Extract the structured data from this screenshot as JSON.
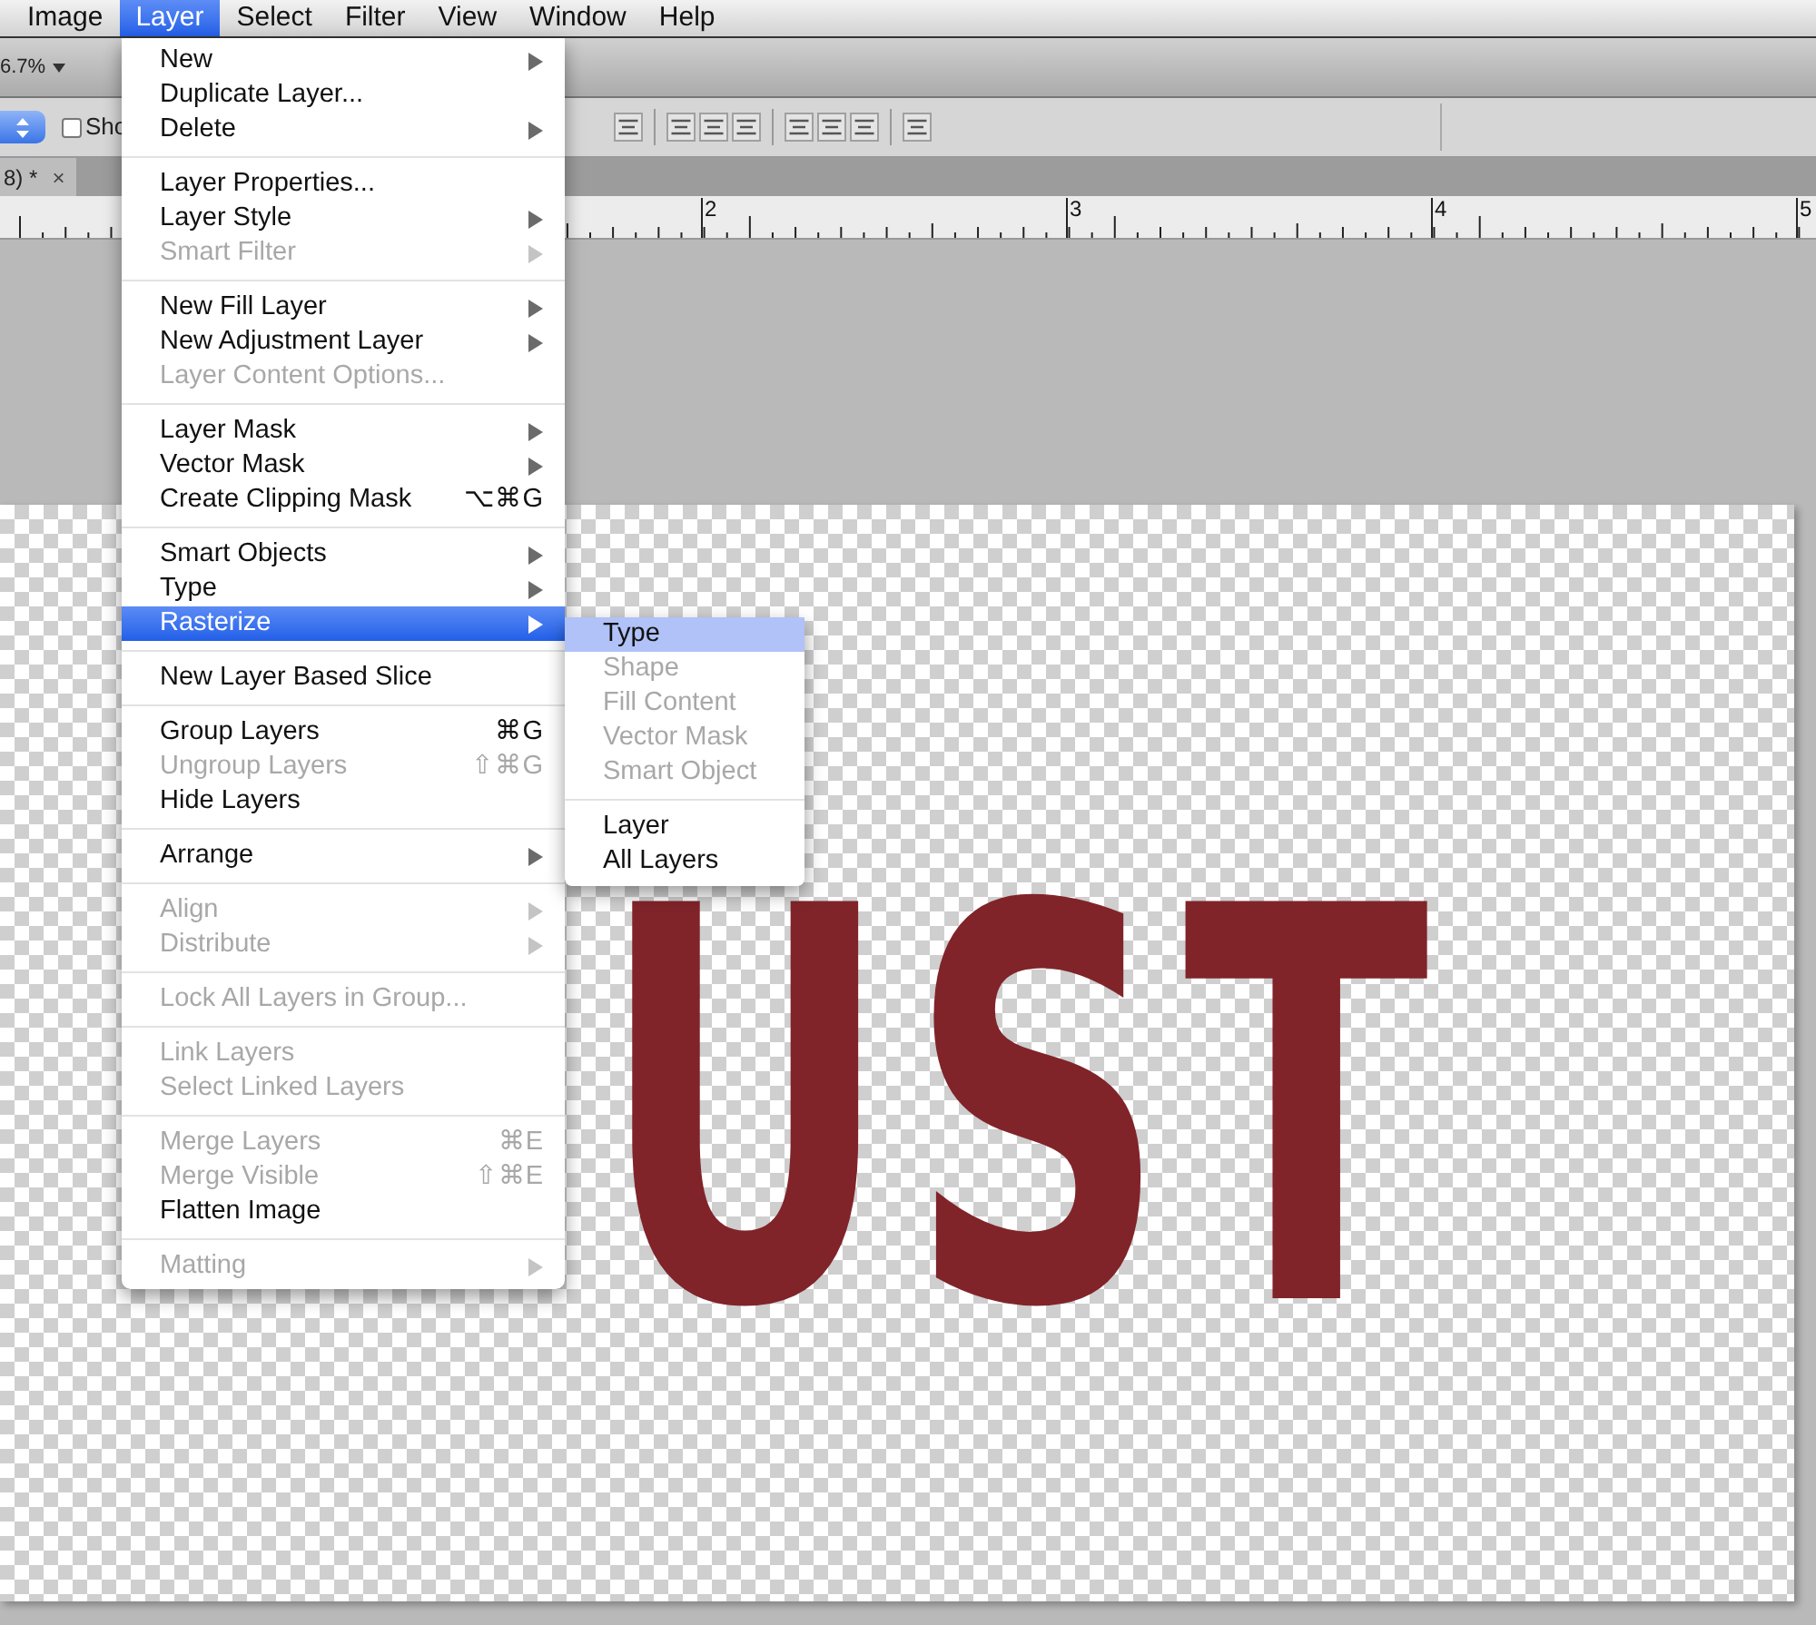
{
  "menu_bar": [
    {
      "label": "Image",
      "selected": false
    },
    {
      "label": "Layer",
      "selected": true
    },
    {
      "label": "Select",
      "selected": false
    },
    {
      "label": "Filter",
      "selected": false
    },
    {
      "label": "View",
      "selected": false
    },
    {
      "label": "Window",
      "selected": false
    },
    {
      "label": "Help",
      "selected": false
    }
  ],
  "options_bar": {
    "zoom": "6.7%",
    "checkbox_label": "Sho",
    "checked": false
  },
  "document_tab": {
    "title": "8) *",
    "close": "×"
  },
  "ruler": {
    "labels": [
      "2",
      "3",
      "4",
      "5"
    ]
  },
  "canvas": {
    "text": "UST"
  },
  "layer_menu": {
    "groups": [
      [
        {
          "label": "New",
          "submenu": true,
          "disabled": false,
          "selected": false
        },
        {
          "label": "Duplicate Layer...",
          "submenu": false,
          "disabled": false,
          "selected": false
        },
        {
          "label": "Delete",
          "submenu": true,
          "disabled": false,
          "selected": false
        }
      ],
      [
        {
          "label": "Layer Properties...",
          "submenu": false,
          "disabled": false,
          "selected": false
        },
        {
          "label": "Layer Style",
          "submenu": true,
          "disabled": false,
          "selected": false
        },
        {
          "label": "Smart Filter",
          "submenu": true,
          "disabled": true,
          "selected": false
        }
      ],
      [
        {
          "label": "New Fill Layer",
          "submenu": true,
          "disabled": false,
          "selected": false
        },
        {
          "label": "New Adjustment Layer",
          "submenu": true,
          "disabled": false,
          "selected": false
        },
        {
          "label": "Layer Content Options...",
          "submenu": false,
          "disabled": true,
          "selected": false
        }
      ],
      [
        {
          "label": "Layer Mask",
          "submenu": true,
          "disabled": false,
          "selected": false
        },
        {
          "label": "Vector Mask",
          "submenu": true,
          "disabled": false,
          "selected": false
        },
        {
          "label": "Create Clipping Mask",
          "shortcut": "⌥⌘G",
          "submenu": false,
          "disabled": false,
          "selected": false
        }
      ],
      [
        {
          "label": "Smart Objects",
          "submenu": true,
          "disabled": false,
          "selected": false
        },
        {
          "label": "Type",
          "submenu": true,
          "disabled": false,
          "selected": false
        },
        {
          "label": "Rasterize",
          "submenu": true,
          "disabled": false,
          "selected": true
        }
      ],
      [
        {
          "label": "New Layer Based Slice",
          "submenu": false,
          "disabled": false,
          "selected": false
        }
      ],
      [
        {
          "label": "Group Layers",
          "shortcut": "⌘G",
          "submenu": false,
          "disabled": false,
          "selected": false
        },
        {
          "label": "Ungroup Layers",
          "shortcut": "⇧⌘G",
          "submenu": false,
          "disabled": true,
          "selected": false
        },
        {
          "label": "Hide Layers",
          "submenu": false,
          "disabled": false,
          "selected": false
        }
      ],
      [
        {
          "label": "Arrange",
          "submenu": true,
          "disabled": false,
          "selected": false
        }
      ],
      [
        {
          "label": "Align",
          "submenu": true,
          "disabled": true,
          "selected": false
        },
        {
          "label": "Distribute",
          "submenu": true,
          "disabled": true,
          "selected": false
        }
      ],
      [
        {
          "label": "Lock All Layers in Group...",
          "submenu": false,
          "disabled": true,
          "selected": false
        }
      ],
      [
        {
          "label": "Link Layers",
          "submenu": false,
          "disabled": true,
          "selected": false
        },
        {
          "label": "Select Linked Layers",
          "submenu": false,
          "disabled": true,
          "selected": false
        }
      ],
      [
        {
          "label": "Merge Layers",
          "shortcut": "⌘E",
          "submenu": false,
          "disabled": true,
          "selected": false
        },
        {
          "label": "Merge Visible",
          "shortcut": "⇧⌘E",
          "submenu": false,
          "disabled": true,
          "selected": false
        },
        {
          "label": "Flatten Image",
          "submenu": false,
          "disabled": false,
          "selected": false
        }
      ],
      [
        {
          "label": "Matting",
          "submenu": true,
          "disabled": true,
          "selected": false
        }
      ]
    ]
  },
  "rasterize_submenu": {
    "groups": [
      [
        {
          "label": "Type",
          "disabled": false,
          "selected": true
        },
        {
          "label": "Shape",
          "disabled": true,
          "selected": false
        },
        {
          "label": "Fill Content",
          "disabled": true,
          "selected": false
        },
        {
          "label": "Vector Mask",
          "disabled": true,
          "selected": false
        },
        {
          "label": "Smart Object",
          "disabled": true,
          "selected": false
        }
      ],
      [
        {
          "label": "Layer",
          "disabled": false,
          "selected": false
        },
        {
          "label": "All Layers",
          "disabled": false,
          "selected": false
        }
      ]
    ]
  }
}
